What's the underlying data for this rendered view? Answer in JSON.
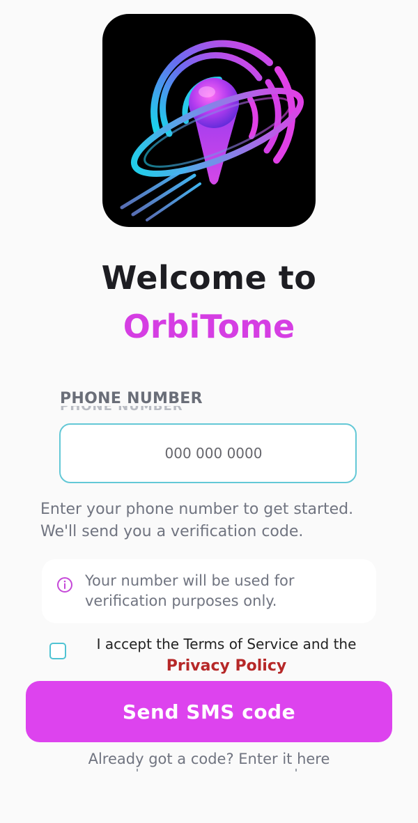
{
  "app": {
    "welcome_line": "Welcome to",
    "brand_name": "OrbiTome",
    "brand_color": "#d53ee3",
    "logo_icon": "orbit-location-pin-icon"
  },
  "phone": {
    "label": "PHONE NUMBER",
    "placeholder": "000 000 0000",
    "value": ""
  },
  "helper_line1": "Enter your phone number to get started.",
  "helper_line2": "We'll send you a verification code.",
  "info": {
    "icon": "info-icon",
    "line1": "Your number will be used for",
    "line2": "verification purposes only."
  },
  "terms": {
    "checked": false,
    "text": "I accept the Terms of Service and the",
    "link": "Privacy Policy"
  },
  "send_button": {
    "label": "Send SMS code",
    "color": "#dd43ee"
  },
  "already": "Already got a code? Enter it here"
}
